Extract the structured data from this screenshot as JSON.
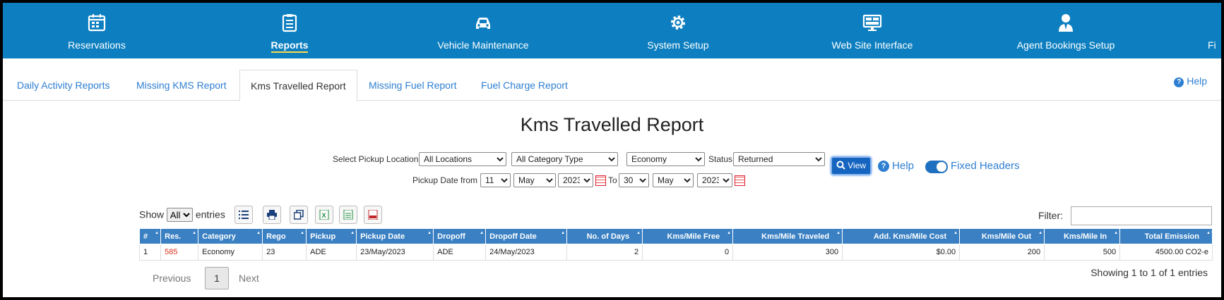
{
  "nav": {
    "items": [
      {
        "label": "Reservations",
        "icon": "calendar-icon"
      },
      {
        "label": "Reports",
        "icon": "clipboard-icon"
      },
      {
        "label": "Vehicle Maintenance",
        "icon": "car-icon"
      },
      {
        "label": "System Setup",
        "icon": "gear-icon"
      },
      {
        "label": "Web Site Interface",
        "icon": "monitor-icon"
      },
      {
        "label": "Agent Bookings Setup",
        "icon": "user-icon"
      },
      {
        "label": "Fi",
        "icon": ""
      }
    ],
    "active": "Reports"
  },
  "tabs": [
    {
      "label": "Daily Activity Reports"
    },
    {
      "label": "Missing KMS Report"
    },
    {
      "label": "Kms Travelled Report"
    },
    {
      "label": "Missing Fuel Report"
    },
    {
      "label": "Fuel Charge Report"
    }
  ],
  "help_label": "Help",
  "title": "Kms Travelled Report",
  "filters": {
    "pickup_location_label": "Select Pickup Location",
    "location": "All Locations",
    "category_type": "All Category Type",
    "category": "Economy",
    "status_label": "Status",
    "status": "Returned",
    "date_from_label": "Pickup Date from",
    "from_day": "11",
    "from_month": "May",
    "from_year": "2023",
    "to_label": "To",
    "to_day": "30",
    "to_month": "May",
    "to_year": "2023",
    "view_label": "View",
    "help_label": "Help",
    "fixed_headers_label": "Fixed Headers"
  },
  "table_controls": {
    "show_label": "Show",
    "entries_value": "All",
    "entries_label": "entries",
    "filter_label": "Filter:",
    "filter_value": ""
  },
  "table": {
    "columns": [
      "#",
      "Res.",
      "Category",
      "Rego",
      "Pickup",
      "Pickup Date",
      "Dropoff",
      "Dropoff Date",
      "No. of Days",
      "Kms/Mile Free",
      "Kms/Mile Traveled",
      "Add. Kms/Mile Cost",
      "Kms/Mile Out",
      "Kms/Mile In",
      "Total Emission"
    ],
    "rows": [
      [
        "1",
        "585",
        "Economy",
        "23",
        "ADE",
        "23/May/2023",
        "ADE",
        "24/May/2023",
        "2",
        "0",
        "300",
        "$0.00",
        "200",
        "500",
        "4500.00 CO2-e"
      ]
    ]
  },
  "pagination": {
    "previous": "Previous",
    "page": "1",
    "next": "Next",
    "summary": "Showing 1 to 1 of 1 entries"
  },
  "colors": {
    "nav_bg": "#0d7fc0",
    "header_bg": "#3a80c3",
    "link": "#2f7fd1",
    "active_underline": "#ffd84a"
  }
}
